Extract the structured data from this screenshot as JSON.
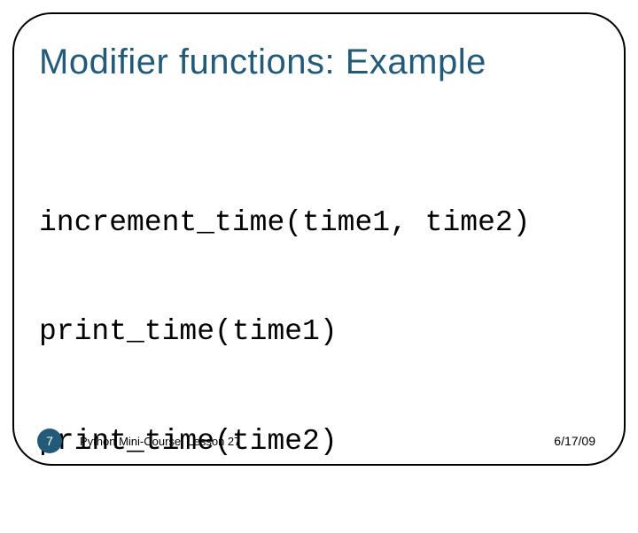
{
  "title": "Modifier functions: Example",
  "code": {
    "lines": [
      "increment_time(time1, time2)",
      "print_time(time1)",
      "print_time(time2)"
    ]
  },
  "footer": {
    "page_number": "7",
    "course": "Python Mini-Course: Lesson 27",
    "date": "6/17/09"
  }
}
